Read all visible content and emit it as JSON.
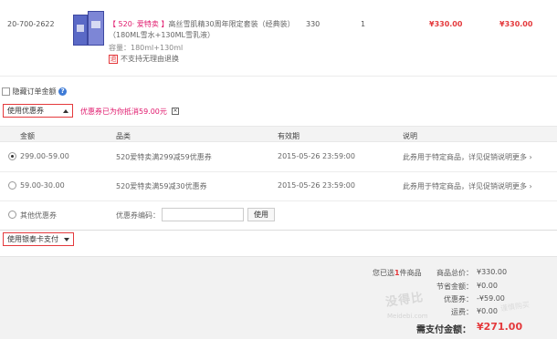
{
  "product": {
    "sku": "20-700-2622",
    "promo_tag": "【 520· 爱特卖 】",
    "name": "高丝雪肌精30周年限定套装（经典装）",
    "name_line2": "（180ML雪水+130ML雪乳液）",
    "capacity": "容量：180ml+130ml",
    "no_return_icon_char": "退",
    "no_return_text": "不支持无理由退换",
    "unit_points": "330",
    "quantity": "1",
    "unit_price": "¥330.00",
    "subtotal": "¥330.00"
  },
  "hide_amount": {
    "label": "隐藏订单金额",
    "help_icon": "?"
  },
  "coupon_bar": {
    "dropdown_label": "使用优惠券",
    "notice": "优惠券已为你抵消59.00元",
    "close_icon": "×"
  },
  "coupon_table": {
    "headers": [
      "金额",
      "品类",
      "有效期",
      "说明"
    ],
    "rows": [
      {
        "amount": "299.00-59.00",
        "category": "520爱特卖满299减59优惠券",
        "expiry": "2015-05-26 23:59:00",
        "desc": "此券用于特定商品，详见促销说明",
        "more": "更多 ›",
        "selected": true
      },
      {
        "amount": "59.00-30.00",
        "category": "520爱特卖满59减30优惠券",
        "expiry": "2015-05-26 23:59:00",
        "desc": "此券用于特定商品，详见促销说明",
        "more": "更多 ›",
        "selected": false
      }
    ],
    "other": {
      "label": "其他优惠券",
      "code_label": "优惠券编码：",
      "code_value": "",
      "use_button": "使用"
    }
  },
  "bank_card": {
    "dropdown_label": "使用银泰卡支付"
  },
  "summary": {
    "selected_prefix": "您已选",
    "selected_count": "1",
    "selected_suffix": "件商品",
    "goods_total_label": "商品总价：",
    "goods_total": "¥330.00",
    "saving_label": "节省金额：",
    "saving": "¥0.00",
    "coupon_label": "优惠券：",
    "coupon": "-¥59.00",
    "shipping_label": "运费：",
    "shipping": "¥0.00",
    "pay_label": "需支付金额：",
    "pay_total": "¥271.00"
  },
  "watermark": {
    "main": "没得比",
    "sub": "Meidebi.com",
    "tail": "谨慎购买"
  },
  "colors": {
    "accent_red": "#e4393c",
    "accent_pink": "#e0186c",
    "link_blue": "#3e7bd6"
  }
}
